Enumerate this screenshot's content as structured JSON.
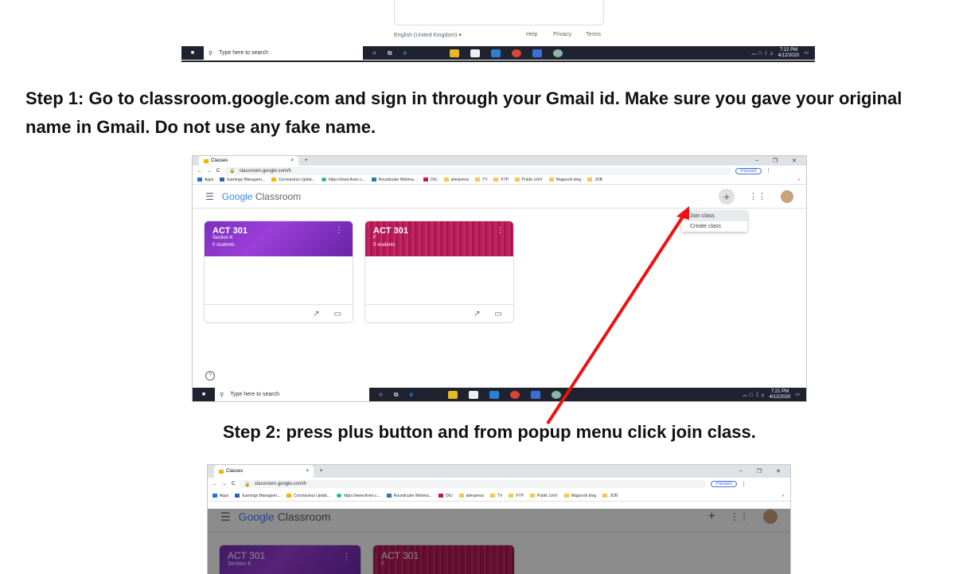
{
  "top_shot": {
    "language": "English (United Kingdom)",
    "links": [
      "Help",
      "Privacy",
      "Terms"
    ],
    "taskbar": {
      "search_placeholder": "Type here to search",
      "time": "7:22 PM",
      "date": "4/12/2020"
    }
  },
  "step1_text": "Step 1: Go to classroom.google.com and sign in through your Gmail id. Make sure you gave your original name in Gmail. Do not use any fake name.",
  "step2_text": "Step 2: press plus button and from popup menu click join class.",
  "browser": {
    "tab_title": "Classes",
    "tab_close": "×",
    "new_tab": "+",
    "window_controls": [
      "–",
      "❐",
      "✕"
    ],
    "nav": [
      "←",
      "→",
      "C"
    ],
    "url": "classroom.google.com/h",
    "profile_status": "Paused",
    "bookmarks": [
      "Apps",
      "Earnings Managem...",
      "Coronavirus Updat...",
      "https://www.fiverr.c...",
      "Roundcube Webma...",
      "DIU",
      "aliexpress",
      "TV",
      "FTP",
      "Public UniV",
      "Magoosh blog",
      "JOB"
    ],
    "bookmarks_more": "»"
  },
  "classroom": {
    "logo_word": "Google",
    "logo_product": "Classroom",
    "menu_items": [
      "Join class",
      "Create class"
    ],
    "help_icon": "?",
    "cards": [
      {
        "title": "ACT 301",
        "section": "Section K",
        "students": "0 students"
      },
      {
        "title": "ACT 301",
        "section": "F",
        "students": "0 students"
      }
    ]
  },
  "taskbar2": {
    "search_placeholder": "Type here to search",
    "time": "7:21 PM",
    "date": "4/12/2020"
  },
  "icons": [
    "windows-icon",
    "search-icon",
    "cortana-icon",
    "task-view-icon",
    "edge-icon",
    "file-explorer-icon",
    "store-icon",
    "mail-icon",
    "chrome-icon",
    "arrow-annotation"
  ],
  "colors": {
    "card_purple": "#7b2fbe",
    "card_magenta": "#b51d5c",
    "arrow_red": "#ee1111",
    "taskbar": "#1f2330"
  }
}
